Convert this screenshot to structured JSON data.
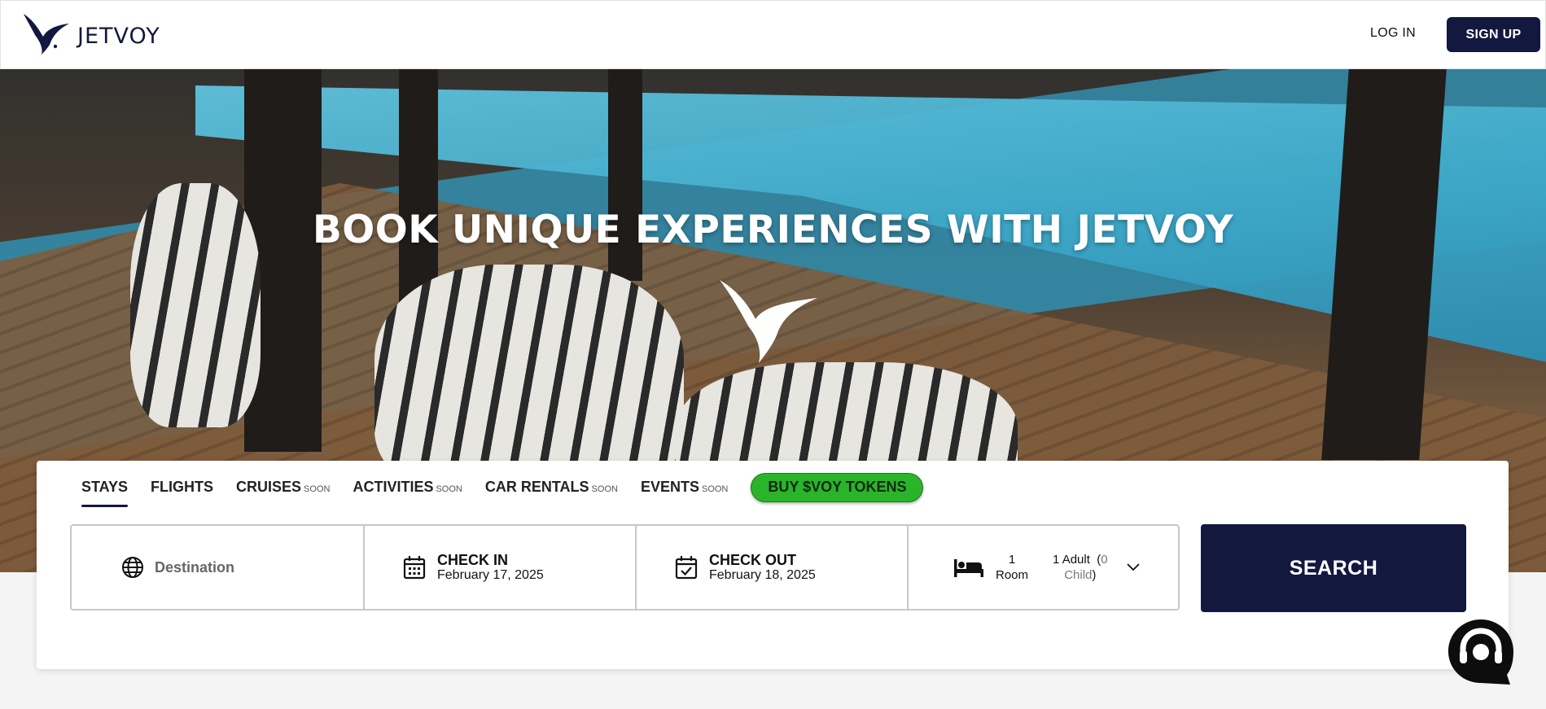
{
  "header": {
    "logo_text": "JETVOY",
    "login_label": "LOG IN",
    "signup_label": "SIGN UP"
  },
  "hero": {
    "title": "BOOK UNIQUE EXPERIENCES WITH JETVOY"
  },
  "tabs": [
    {
      "label": "STAYS",
      "soon": "",
      "active": true
    },
    {
      "label": "FLIGHTS",
      "soon": ""
    },
    {
      "label": "CRUISES",
      "soon": "SOON"
    },
    {
      "label": "ACTIVITIES",
      "soon": "SOON"
    },
    {
      "label": "CAR RENTALS",
      "soon": "SOON"
    },
    {
      "label": "EVENTS",
      "soon": "SOON"
    }
  ],
  "tokens_label": "BUY $VOY TOKENS",
  "search": {
    "destination_placeholder": "Destination",
    "check_in_label": "CHECK IN",
    "check_in_value": "February 17, 2025",
    "check_out_label": "CHECK OUT",
    "check_out_value": "February 18, 2025",
    "rooms_count": "1",
    "rooms_label": "Room",
    "adults": "1 Adult",
    "children_open": "(",
    "children_num": "0",
    "children_label": "Child",
    "children_close": ")",
    "button_label": "SEARCH"
  },
  "colors": {
    "brand_navy": "#13183f",
    "token_green": "#2ab42a"
  },
  "icons": [
    "jetvoy-bird-icon",
    "globe-icon",
    "calendar-icon",
    "calendar-check-icon",
    "bed-icon",
    "chevron-down-icon",
    "chat-support-icon"
  ]
}
